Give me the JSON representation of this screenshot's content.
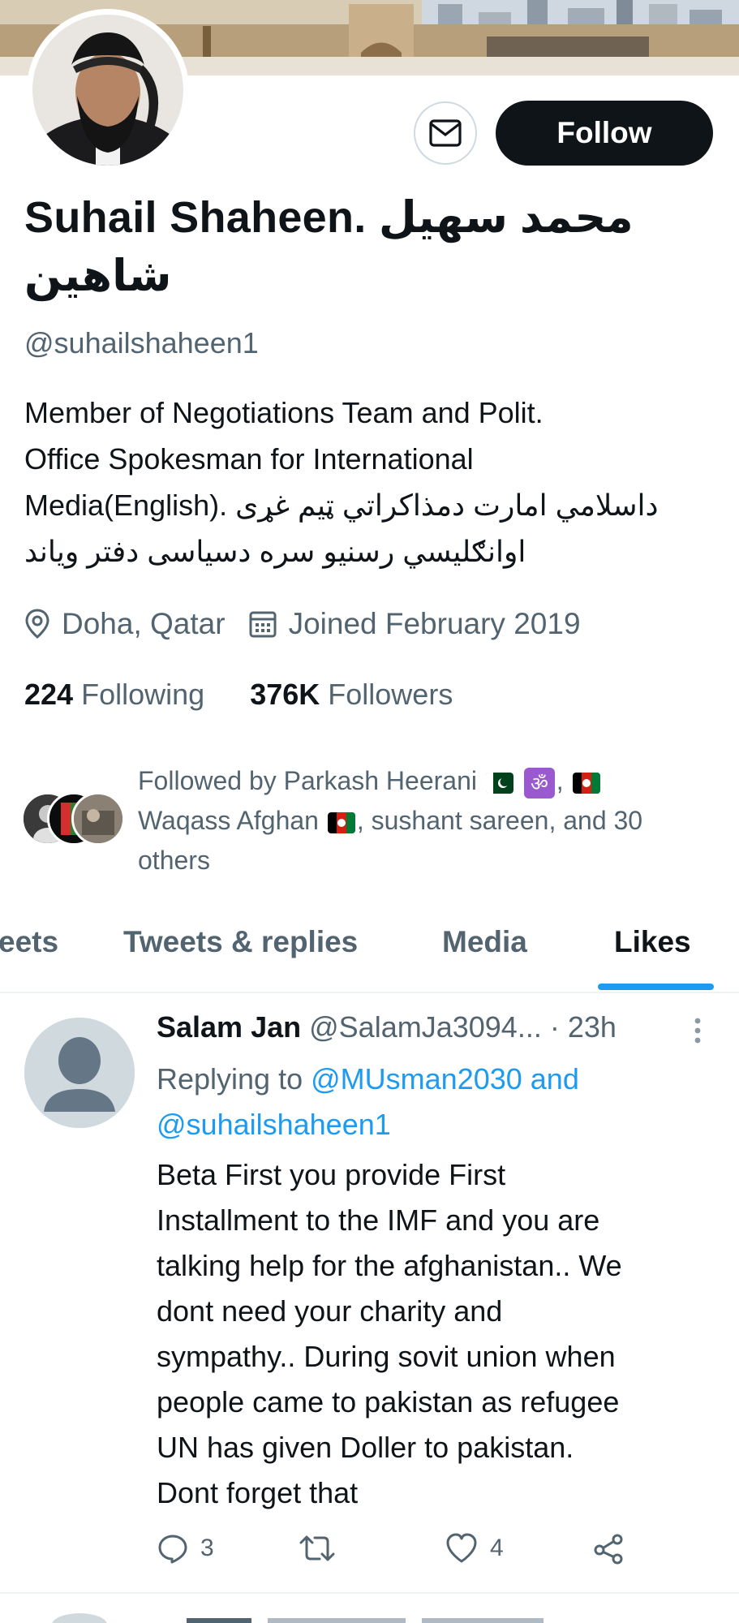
{
  "profile": {
    "name": "Suhail Shaheen. محمد سهیل شاهین",
    "name_latin": "Suhail Shaheen.",
    "name_arabic_1": "محمد سهیل",
    "name_arabic_2": "شاهین",
    "handle": "@suhailshaheen1",
    "bio_lines": [
      "Member of Negotiations Team and Polit.",
      "Office Spokesman for International",
      "Media(English). داسلامي امارت دمذاکراتي ټیم غړی",
      "اوانګلیسي رسنیو سره دسیاسی دفتر ویاند"
    ],
    "location": "Doha, Qatar",
    "joined": "Joined February 2019",
    "following_count": "224",
    "following_label": "Following",
    "followers_count": "376K",
    "followers_label": "Followers",
    "followed_by": {
      "prefix": "Followed by Parkash Heerani",
      "line2": "Waqass Afghan",
      "line2_suffix": ", sushant sareen, and 30",
      "line3": "others"
    }
  },
  "actions": {
    "follow_label": "Follow",
    "message_icon": "envelope-icon"
  },
  "tabs": [
    {
      "label": "Tweets",
      "visible_text": "eets"
    },
    {
      "label": "Tweets & replies"
    },
    {
      "label": "Media"
    },
    {
      "label": "Likes",
      "active": true
    }
  ],
  "tweet": {
    "author": "Salam Jan",
    "handle": "@SalamJa3094...",
    "time": "· 23h",
    "reply_prefix": "Replying to",
    "reply_to_1": "@MUsman2030 and",
    "reply_to_2": "@suhailshaheen1",
    "body_lines": [
      "Beta First you provide First",
      "Installment to the IMF and you are",
      "talking help for the afghanistan.. We",
      "dont need your charity and",
      "sympathy.. During sovit union when",
      "people came to pakistan as refugee",
      "UN has given Doller to pakistan.",
      "Dont forget that"
    ],
    "reply_count": "3",
    "like_count": "4"
  },
  "colors": {
    "accent": "#1d9bf0",
    "text": "#0f1419",
    "muted": "#536471",
    "button_dark": "#0f1419"
  }
}
